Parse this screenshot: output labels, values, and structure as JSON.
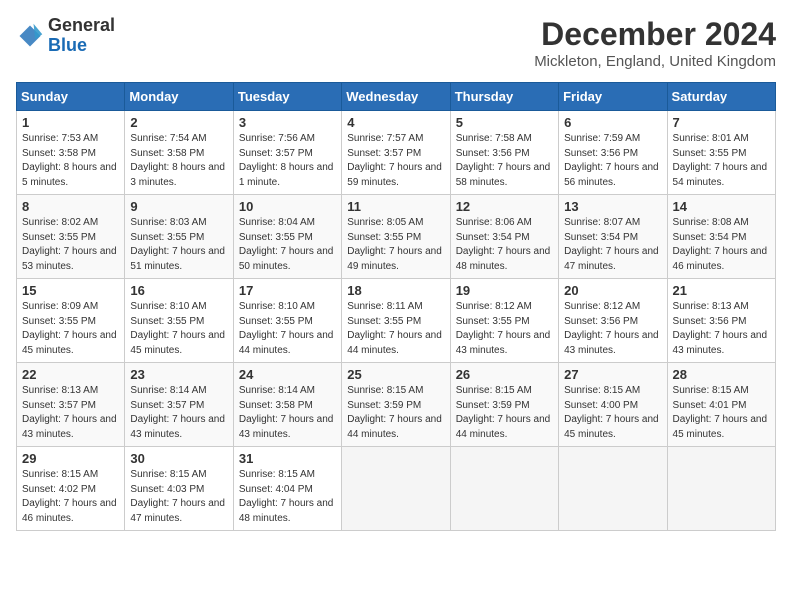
{
  "header": {
    "logo_line1": "General",
    "logo_line2": "Blue",
    "month_title": "December 2024",
    "location": "Mickleton, England, United Kingdom"
  },
  "days_of_week": [
    "Sunday",
    "Monday",
    "Tuesday",
    "Wednesday",
    "Thursday",
    "Friday",
    "Saturday"
  ],
  "weeks": [
    [
      {
        "num": "1",
        "sunrise": "7:53 AM",
        "sunset": "3:58 PM",
        "daylight": "8 hours and 5 minutes."
      },
      {
        "num": "2",
        "sunrise": "7:54 AM",
        "sunset": "3:58 PM",
        "daylight": "8 hours and 3 minutes."
      },
      {
        "num": "3",
        "sunrise": "7:56 AM",
        "sunset": "3:57 PM",
        "daylight": "8 hours and 1 minute."
      },
      {
        "num": "4",
        "sunrise": "7:57 AM",
        "sunset": "3:57 PM",
        "daylight": "7 hours and 59 minutes."
      },
      {
        "num": "5",
        "sunrise": "7:58 AM",
        "sunset": "3:56 PM",
        "daylight": "7 hours and 58 minutes."
      },
      {
        "num": "6",
        "sunrise": "7:59 AM",
        "sunset": "3:56 PM",
        "daylight": "7 hours and 56 minutes."
      },
      {
        "num": "7",
        "sunrise": "8:01 AM",
        "sunset": "3:55 PM",
        "daylight": "7 hours and 54 minutes."
      }
    ],
    [
      {
        "num": "8",
        "sunrise": "8:02 AM",
        "sunset": "3:55 PM",
        "daylight": "7 hours and 53 minutes."
      },
      {
        "num": "9",
        "sunrise": "8:03 AM",
        "sunset": "3:55 PM",
        "daylight": "7 hours and 51 minutes."
      },
      {
        "num": "10",
        "sunrise": "8:04 AM",
        "sunset": "3:55 PM",
        "daylight": "7 hours and 50 minutes."
      },
      {
        "num": "11",
        "sunrise": "8:05 AM",
        "sunset": "3:55 PM",
        "daylight": "7 hours and 49 minutes."
      },
      {
        "num": "12",
        "sunrise": "8:06 AM",
        "sunset": "3:54 PM",
        "daylight": "7 hours and 48 minutes."
      },
      {
        "num": "13",
        "sunrise": "8:07 AM",
        "sunset": "3:54 PM",
        "daylight": "7 hours and 47 minutes."
      },
      {
        "num": "14",
        "sunrise": "8:08 AM",
        "sunset": "3:54 PM",
        "daylight": "7 hours and 46 minutes."
      }
    ],
    [
      {
        "num": "15",
        "sunrise": "8:09 AM",
        "sunset": "3:55 PM",
        "daylight": "7 hours and 45 minutes."
      },
      {
        "num": "16",
        "sunrise": "8:10 AM",
        "sunset": "3:55 PM",
        "daylight": "7 hours and 45 minutes."
      },
      {
        "num": "17",
        "sunrise": "8:10 AM",
        "sunset": "3:55 PM",
        "daylight": "7 hours and 44 minutes."
      },
      {
        "num": "18",
        "sunrise": "8:11 AM",
        "sunset": "3:55 PM",
        "daylight": "7 hours and 44 minutes."
      },
      {
        "num": "19",
        "sunrise": "8:12 AM",
        "sunset": "3:55 PM",
        "daylight": "7 hours and 43 minutes."
      },
      {
        "num": "20",
        "sunrise": "8:12 AM",
        "sunset": "3:56 PM",
        "daylight": "7 hours and 43 minutes."
      },
      {
        "num": "21",
        "sunrise": "8:13 AM",
        "sunset": "3:56 PM",
        "daylight": "7 hours and 43 minutes."
      }
    ],
    [
      {
        "num": "22",
        "sunrise": "8:13 AM",
        "sunset": "3:57 PM",
        "daylight": "7 hours and 43 minutes."
      },
      {
        "num": "23",
        "sunrise": "8:14 AM",
        "sunset": "3:57 PM",
        "daylight": "7 hours and 43 minutes."
      },
      {
        "num": "24",
        "sunrise": "8:14 AM",
        "sunset": "3:58 PM",
        "daylight": "7 hours and 43 minutes."
      },
      {
        "num": "25",
        "sunrise": "8:15 AM",
        "sunset": "3:59 PM",
        "daylight": "7 hours and 44 minutes."
      },
      {
        "num": "26",
        "sunrise": "8:15 AM",
        "sunset": "3:59 PM",
        "daylight": "7 hours and 44 minutes."
      },
      {
        "num": "27",
        "sunrise": "8:15 AM",
        "sunset": "4:00 PM",
        "daylight": "7 hours and 45 minutes."
      },
      {
        "num": "28",
        "sunrise": "8:15 AM",
        "sunset": "4:01 PM",
        "daylight": "7 hours and 45 minutes."
      }
    ],
    [
      {
        "num": "29",
        "sunrise": "8:15 AM",
        "sunset": "4:02 PM",
        "daylight": "7 hours and 46 minutes."
      },
      {
        "num": "30",
        "sunrise": "8:15 AM",
        "sunset": "4:03 PM",
        "daylight": "7 hours and 47 minutes."
      },
      {
        "num": "31",
        "sunrise": "8:15 AM",
        "sunset": "4:04 PM",
        "daylight": "7 hours and 48 minutes."
      },
      null,
      null,
      null,
      null
    ]
  ]
}
